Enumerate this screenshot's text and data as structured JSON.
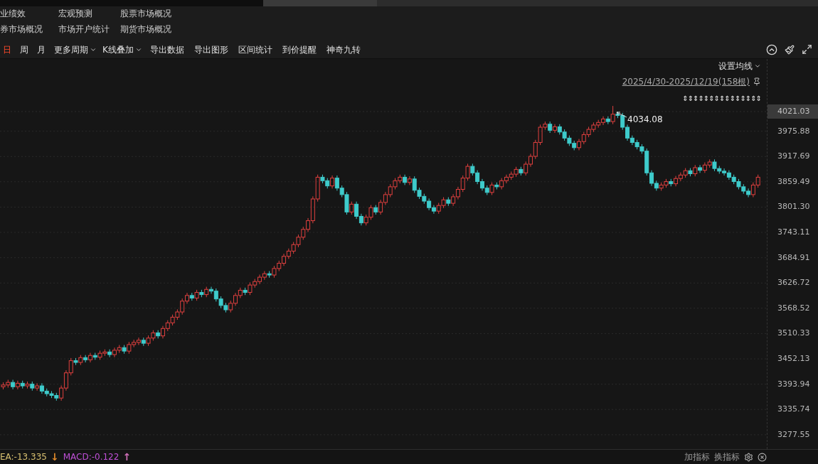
{
  "menu_links": [
    {
      "label": "业绩效"
    },
    {
      "label": "宏观预测"
    },
    {
      "label": "股票市场概况"
    },
    {
      "label": "券市场概况"
    },
    {
      "label": "市场开户统计"
    },
    {
      "label": "期货市场概况"
    }
  ],
  "toolbar": {
    "periods": [
      {
        "label": "日",
        "selected": true
      },
      {
        "label": "周",
        "selected": false
      },
      {
        "label": "月",
        "selected": false
      }
    ],
    "actions": [
      {
        "label": "更多周期",
        "kind": "dropdown"
      },
      {
        "label": "K线叠加",
        "kind": "dropdown"
      },
      {
        "label": "导出数据",
        "kind": "button"
      },
      {
        "label": "导出图形",
        "kind": "button"
      },
      {
        "label": "区间统计",
        "kind": "button"
      },
      {
        "label": "到价提醒",
        "kind": "button"
      },
      {
        "label": "神奇九转",
        "kind": "button"
      }
    ]
  },
  "chart": {
    "ma_setting": "设置均线",
    "date_range": "2025/4/30-2025/12/19(158根)",
    "markers": "⇕⇕⇕⇕⇕⇕⇕⇕⇕⇕⇕⇕⇕⇕⇕",
    "max_label": "4034.08",
    "current_price": "4021.03",
    "chart_data": {
      "type": "candlestick",
      "grid": true,
      "ylim": [
        3239.7,
        4142.0
      ],
      "yticks": [
        {
          "value": 3975.88,
          "label": "3975.88"
        },
        {
          "value": 3917.69,
          "label": "3917.69"
        },
        {
          "value": 3859.49,
          "label": "3859.49"
        },
        {
          "value": 3801.3,
          "label": "3801.30"
        },
        {
          "value": 3743.11,
          "label": "3743.11"
        },
        {
          "value": 3684.91,
          "label": "3684.91"
        },
        {
          "value": 3626.72,
          "label": "3626.72"
        },
        {
          "value": 3568.52,
          "label": "3568.52"
        },
        {
          "value": 3510.33,
          "label": "3510.33"
        },
        {
          "value": 3452.13,
          "label": "3452.13"
        },
        {
          "value": 3393.94,
          "label": "3393.94"
        },
        {
          "value": 3335.74,
          "label": "3335.74"
        },
        {
          "value": 3277.55,
          "label": "3277.55"
        }
      ],
      "ohlc": [
        [
          3388,
          3398,
          3382,
          3392
        ],
        [
          3392,
          3404,
          3386,
          3398
        ],
        [
          3398,
          3404,
          3382,
          3388
        ],
        [
          3388,
          3402,
          3382,
          3396
        ],
        [
          3396,
          3402,
          3384,
          3390
        ],
        [
          3390,
          3400,
          3384,
          3394
        ],
        [
          3394,
          3400,
          3379,
          3385
        ],
        [
          3385,
          3396,
          3379,
          3390
        ],
        [
          3390,
          3396,
          3372,
          3378
        ],
        [
          3378,
          3384,
          3366,
          3372
        ],
        [
          3372,
          3378,
          3362,
          3368
        ],
        [
          3368,
          3374,
          3356,
          3362
        ],
        [
          3362,
          3391,
          3356,
          3385
        ],
        [
          3385,
          3426,
          3379,
          3420
        ],
        [
          3420,
          3454,
          3414,
          3448
        ],
        [
          3448,
          3454,
          3438,
          3444
        ],
        [
          3444,
          3461,
          3438,
          3455
        ],
        [
          3455,
          3461,
          3444,
          3450
        ],
        [
          3450,
          3466,
          3444,
          3460
        ],
        [
          3460,
          3466,
          3450,
          3456
        ],
        [
          3456,
          3471,
          3450,
          3465
        ],
        [
          3465,
          3474,
          3459,
          3468
        ],
        [
          3468,
          3474,
          3456,
          3462
        ],
        [
          3462,
          3478,
          3456,
          3472
        ],
        [
          3472,
          3484,
          3466,
          3478
        ],
        [
          3478,
          3484,
          3464,
          3470
        ],
        [
          3470,
          3491,
          3464,
          3485
        ],
        [
          3485,
          3496,
          3479,
          3490
        ],
        [
          3490,
          3501,
          3484,
          3495
        ],
        [
          3495,
          3501,
          3482,
          3488
        ],
        [
          3488,
          3506,
          3482,
          3500
        ],
        [
          3500,
          3518,
          3494,
          3512
        ],
        [
          3512,
          3518,
          3499,
          3505
        ],
        [
          3505,
          3528,
          3499,
          3522
        ],
        [
          3522,
          3541,
          3516,
          3535
        ],
        [
          3535,
          3554,
          3529,
          3548
        ],
        [
          3548,
          3566,
          3542,
          3560
        ],
        [
          3560,
          3591,
          3554,
          3585
        ],
        [
          3585,
          3604,
          3579,
          3598
        ],
        [
          3598,
          3604,
          3586,
          3592
        ],
        [
          3592,
          3611,
          3586,
          3605
        ],
        [
          3605,
          3611,
          3594,
          3600
        ],
        [
          3600,
          3618,
          3594,
          3612
        ],
        [
          3612,
          3618,
          3602,
          3608
        ],
        [
          3608,
          3614,
          3584,
          3590
        ],
        [
          3590,
          3596,
          3569,
          3575
        ],
        [
          3575,
          3581,
          3559,
          3565
        ],
        [
          3565,
          3586,
          3559,
          3580
        ],
        [
          3580,
          3604,
          3574,
          3598
        ],
        [
          3598,
          3616,
          3592,
          3610
        ],
        [
          3610,
          3616,
          3599,
          3605
        ],
        [
          3605,
          3628,
          3599,
          3622
        ],
        [
          3622,
          3636,
          3616,
          3630
        ],
        [
          3630,
          3646,
          3624,
          3640
        ],
        [
          3640,
          3654,
          3634,
          3648
        ],
        [
          3648,
          3654,
          3639,
          3645
        ],
        [
          3645,
          3666,
          3639,
          3660
        ],
        [
          3660,
          3678,
          3654,
          3672
        ],
        [
          3672,
          3694,
          3666,
          3688
        ],
        [
          3688,
          3706,
          3682,
          3700
        ],
        [
          3700,
          3721,
          3694,
          3715
        ],
        [
          3715,
          3738,
          3709,
          3732
        ],
        [
          3732,
          3756,
          3726,
          3750
        ],
        [
          3750,
          3776,
          3744,
          3770
        ],
        [
          3770,
          3826,
          3764,
          3820
        ],
        [
          3820,
          3876,
          3814,
          3870
        ],
        [
          3870,
          3876,
          3856,
          3862
        ],
        [
          3862,
          3868,
          3844,
          3850
        ],
        [
          3850,
          3874,
          3844,
          3868
        ],
        [
          3868,
          3874,
          3839,
          3845
        ],
        [
          3845,
          3851,
          3824,
          3830
        ],
        [
          3830,
          3836,
          3784,
          3790
        ],
        [
          3790,
          3814,
          3784,
          3808
        ],
        [
          3808,
          3814,
          3774,
          3780
        ],
        [
          3780,
          3786,
          3759,
          3765
        ],
        [
          3765,
          3784,
          3759,
          3778
        ],
        [
          3778,
          3806,
          3772,
          3800
        ],
        [
          3800,
          3806,
          3784,
          3790
        ],
        [
          3790,
          3818,
          3784,
          3812
        ],
        [
          3812,
          3836,
          3806,
          3830
        ],
        [
          3830,
          3854,
          3824,
          3848
        ],
        [
          3848,
          3868,
          3842,
          3862
        ],
        [
          3862,
          3876,
          3856,
          3870
        ],
        [
          3870,
          3876,
          3852,
          3858
        ],
        [
          3858,
          3872,
          3852,
          3866
        ],
        [
          3866,
          3872,
          3834,
          3840
        ],
        [
          3840,
          3846,
          3820,
          3826
        ],
        [
          3826,
          3832,
          3809,
          3815
        ],
        [
          3815,
          3821,
          3794,
          3800
        ],
        [
          3800,
          3806,
          3786,
          3792
        ],
        [
          3792,
          3811,
          3786,
          3805
        ],
        [
          3805,
          3824,
          3799,
          3818
        ],
        [
          3818,
          3824,
          3804,
          3810
        ],
        [
          3810,
          3831,
          3804,
          3825
        ],
        [
          3825,
          3848,
          3819,
          3842
        ],
        [
          3842,
          3874,
          3836,
          3868
        ],
        [
          3868,
          3901,
          3862,
          3895
        ],
        [
          3895,
          3901,
          3874,
          3880
        ],
        [
          3880,
          3886,
          3854,
          3860
        ],
        [
          3860,
          3866,
          3839,
          3845
        ],
        [
          3845,
          3851,
          3829,
          3835
        ],
        [
          3835,
          3858,
          3829,
          3852
        ],
        [
          3852,
          3858,
          3842,
          3848
        ],
        [
          3848,
          3868,
          3842,
          3862
        ],
        [
          3862,
          3876,
          3856,
          3870
        ],
        [
          3870,
          3883,
          3864,
          3877
        ],
        [
          3877,
          3894,
          3871,
          3888
        ],
        [
          3888,
          3894,
          3874,
          3880
        ],
        [
          3880,
          3906,
          3874,
          3900
        ],
        [
          3900,
          3924,
          3894,
          3918
        ],
        [
          3918,
          3956,
          3912,
          3950
        ],
        [
          3950,
          3991,
          3944,
          3985
        ],
        [
          3985,
          3998,
          3979,
          3992
        ],
        [
          3992,
          3998,
          3972,
          3978
        ],
        [
          3978,
          3992,
          3972,
          3986
        ],
        [
          3986,
          3992,
          3968,
          3974
        ],
        [
          3974,
          3980,
          3954,
          3960
        ],
        [
          3960,
          3966,
          3942,
          3948
        ],
        [
          3948,
          3954,
          3932,
          3938
        ],
        [
          3938,
          3958,
          3932,
          3952
        ],
        [
          3952,
          3974,
          3946,
          3968
        ],
        [
          3968,
          3986,
          3962,
          3980
        ],
        [
          3980,
          3996,
          3974,
          3990
        ],
        [
          3990,
          4002,
          3984,
          3996
        ],
        [
          3996,
          4010,
          3990,
          4004
        ],
        [
          4004,
          4010,
          3992,
          3998
        ],
        [
          3998,
          4034,
          3992,
          4015
        ],
        [
          4015,
          4021,
          4006,
          4012
        ],
        [
          4012,
          4018,
          3979,
          3985
        ],
        [
          3985,
          3991,
          3954,
          3960
        ],
        [
          3960,
          3966,
          3944,
          3950
        ],
        [
          3950,
          3956,
          3934,
          3940
        ],
        [
          3940,
          3946,
          3924,
          3930
        ],
        [
          3930,
          3936,
          3874,
          3880
        ],
        [
          3880,
          3886,
          3850,
          3856
        ],
        [
          3856,
          3862,
          3839,
          3845
        ],
        [
          3845,
          3858,
          3839,
          3852
        ],
        [
          3852,
          3866,
          3846,
          3860
        ],
        [
          3860,
          3866,
          3849,
          3855
        ],
        [
          3855,
          3873,
          3849,
          3867
        ],
        [
          3867,
          3881,
          3861,
          3875
        ],
        [
          3875,
          3891,
          3869,
          3885
        ],
        [
          3885,
          3891,
          3872,
          3878
        ],
        [
          3878,
          3898,
          3872,
          3892
        ],
        [
          3892,
          3898,
          3880,
          3886
        ],
        [
          3886,
          3904,
          3880,
          3898
        ],
        [
          3898,
          3911,
          3892,
          3905
        ],
        [
          3905,
          3911,
          3884,
          3890
        ],
        [
          3890,
          3896,
          3878,
          3884
        ],
        [
          3884,
          3890,
          3874,
          3880
        ],
        [
          3880,
          3886,
          3864,
          3870
        ],
        [
          3870,
          3876,
          3854,
          3860
        ],
        [
          3860,
          3866,
          3842,
          3848
        ],
        [
          3848,
          3854,
          3832,
          3838
        ],
        [
          3838,
          3844,
          3824,
          3830
        ],
        [
          3830,
          3858,
          3824,
          3852
        ],
        [
          3852,
          3876,
          3846,
          3870
        ]
      ]
    }
  },
  "indicator": {
    "values": [
      {
        "text": "EA:-13.335",
        "color": "#d8c070",
        "arrow": {
          "glyph": "↓",
          "color": "#e08a2a"
        }
      },
      {
        "text": "MACD:-0.122",
        "color": "#c050d8",
        "arrow": {
          "glyph": "↑",
          "color": "#d070b8"
        }
      }
    ],
    "buttons": [
      "加指标",
      "换指标"
    ]
  }
}
